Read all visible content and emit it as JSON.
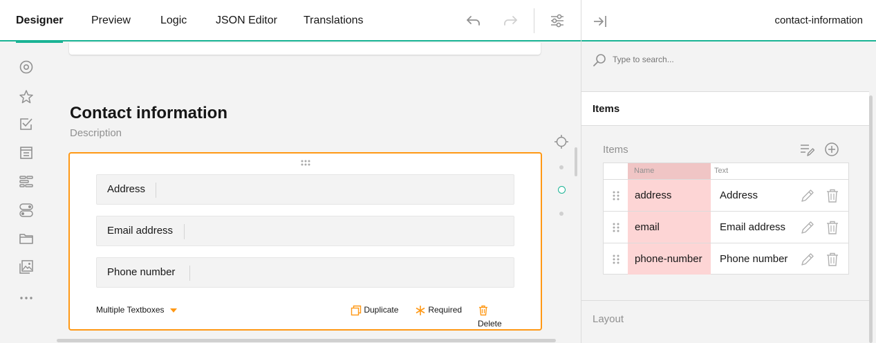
{
  "tabs": [
    "Designer",
    "Preview",
    "Logic",
    "JSON Editor",
    "Translations"
  ],
  "colors": {
    "accent": "#19b394",
    "selection": "#ff9814",
    "error_bg": "#fdd5d5",
    "icon": "#909090"
  },
  "toolbar_icons": [
    "undo-icon",
    "redo-icon",
    "settings-sliders-icon"
  ],
  "toolbox_icons": [
    "radio-icon",
    "rating-star-icon",
    "checkbox-icon",
    "dropdown-icon",
    "ranking-icon",
    "boolean-toggle-icon",
    "file-folder-icon",
    "image-picker-icon",
    "more-dots-icon"
  ],
  "page": {
    "title": "Contact information",
    "description": "Description"
  },
  "question": {
    "rows": [
      {
        "label": "Address"
      },
      {
        "label": "Email address"
      },
      {
        "label": "Phone number"
      }
    ],
    "type_label": "Multiple Textboxes",
    "actions": {
      "duplicate": "Duplicate",
      "required": "Required",
      "delete": "Delete"
    }
  },
  "panel": {
    "title": "contact-information",
    "search_placeholder": "Type to search...",
    "items_section": "Items",
    "items_label": "Items",
    "columns": {
      "name": "Name",
      "text": "Text"
    },
    "items": [
      {
        "name": "address",
        "text": "Address"
      },
      {
        "name": "email",
        "text": "Email address"
      },
      {
        "name": "phone-number",
        "text": "Phone number"
      }
    ],
    "layout_section": "Layout"
  }
}
